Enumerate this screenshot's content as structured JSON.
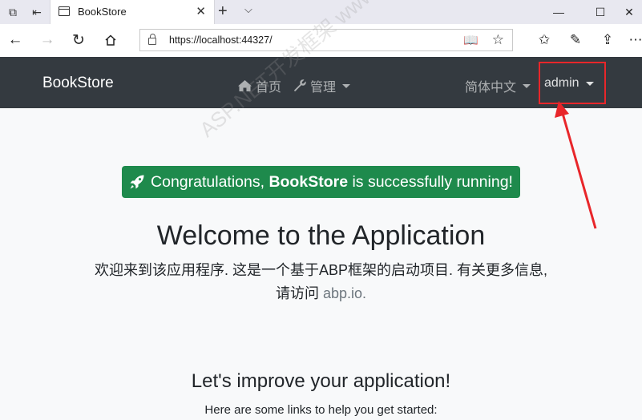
{
  "browser": {
    "tab_title": "BookStore",
    "url": "https://localhost:44327/",
    "new_tab": "+",
    "tab_close": "✕",
    "window_minimize": "—",
    "window_maximize": "☐",
    "window_close": "✕"
  },
  "navbar": {
    "brand": "BookStore",
    "home": "首页",
    "admin_menu": "管理",
    "language": "简体中文",
    "user": "admin"
  },
  "main": {
    "alert_prefix": "Congratulations, ",
    "alert_brand": "BookStore",
    "alert_suffix": " is successfully running!",
    "welcome_title": "Welcome to the Application",
    "lead_text": "欢迎来到该应用程序. 这是一个基于ABP框架的启动项目. 有关更多信息, 请访问 ",
    "lead_link": "abp.io.",
    "improve_title": "Let's improve your application!",
    "links_intro": "Here are some links to help you get started:"
  },
  "watermark": {
    "text": "ASP.NET开发框架 www.yetdotnet.com"
  },
  "colors": {
    "navbar_bg": "#343a40",
    "alert_bg": "#1e8a4c",
    "highlight": "#e8262a"
  }
}
